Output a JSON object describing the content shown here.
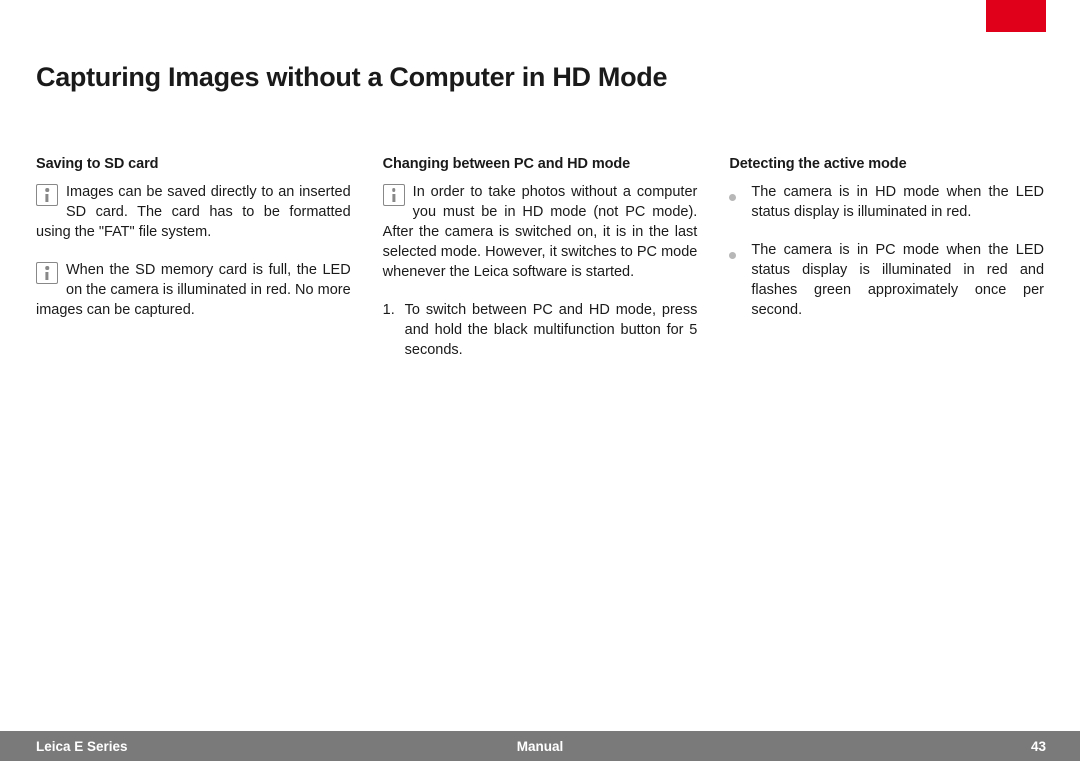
{
  "title": "Capturing Images without a Computer in HD Mode",
  "columns": {
    "c1": {
      "heading": "Saving to SD card",
      "p1": "Images can be saved directly to an inserted SD card. The card has to be formatted using the \"FAT\" file system.",
      "p2": "When the SD memory card is full, the LED on the camera is illuminated in red. No more images can be captured."
    },
    "c2": {
      "heading": "Changing between PC and HD mode",
      "p1": "In order to take photos without a computer you must be in HD mode (not PC mode). After the camera is switched on, it is in the last selected mode. However, it switches to PC mode whenever the Leica software is started.",
      "step1_num": "1.",
      "step1_text": "To switch between PC and HD mode, press and hold the black multifunction button for 5 seconds."
    },
    "c3": {
      "heading": "Detecting the active mode",
      "b1": "The camera is in HD mode when the LED status display is illuminated in red.",
      "b2": "The camera is in PC mode when the LED status display is illuminated in red and flashes green approximately once per second."
    }
  },
  "footer": {
    "left": "Leica E Series",
    "center": "Manual",
    "right": "43"
  }
}
